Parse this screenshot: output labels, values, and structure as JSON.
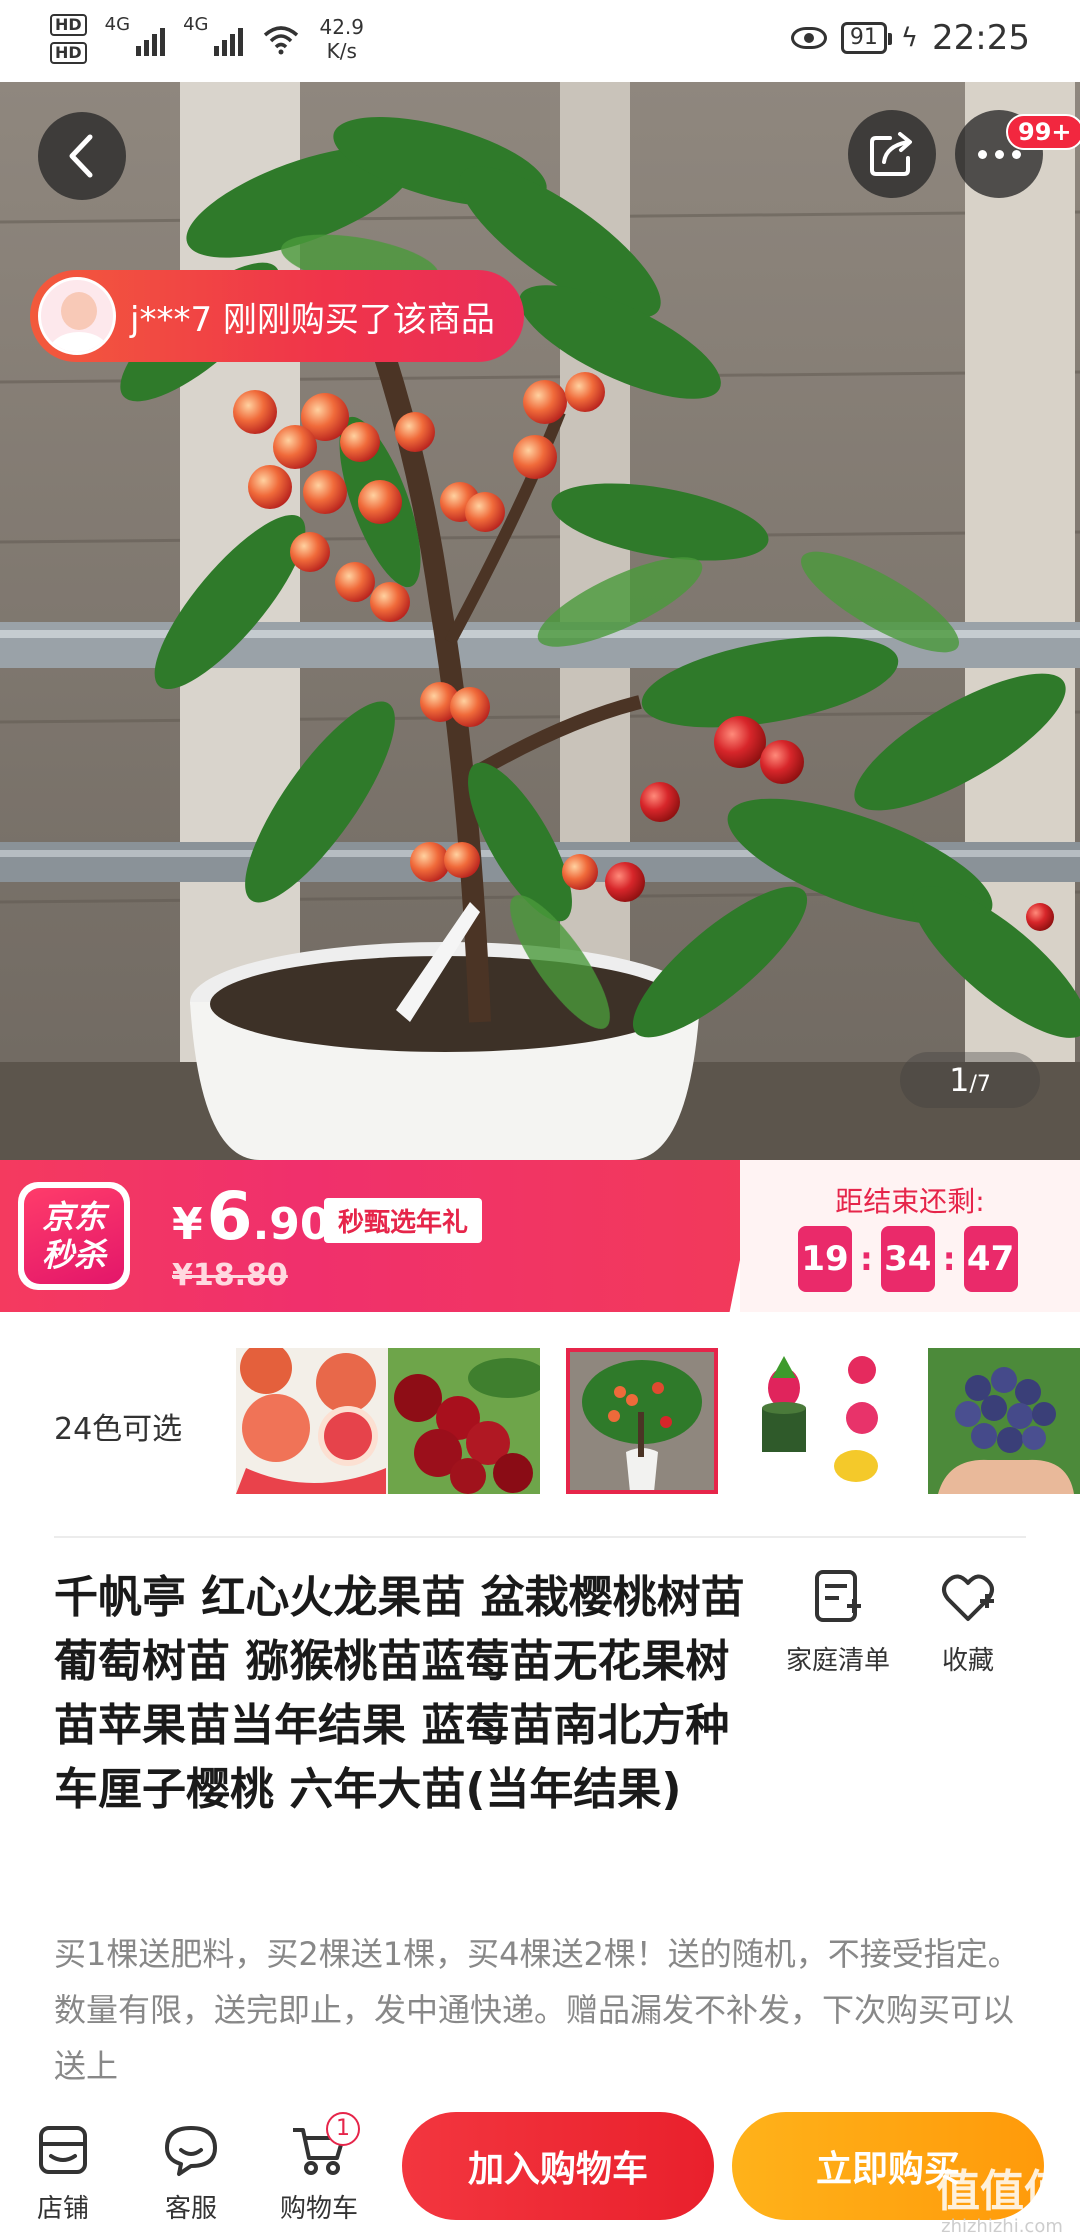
{
  "status_bar": {
    "hd1": "HD",
    "hd2": "HD",
    "net1": "4G",
    "net2": "4G",
    "speed_value": "42.9",
    "speed_unit": "K/s",
    "battery": "91",
    "time": "22:25"
  },
  "hero": {
    "buyer_notice": "j***7 刚刚购买了该商品",
    "more_badge": "99+",
    "page_current": "1",
    "page_total": "/7",
    "icons": {
      "back": "back-arrow-icon",
      "share": "share-icon",
      "more": "more-dots-icon"
    }
  },
  "flash_sale": {
    "logo_line1": "京东",
    "logo_line2": "秒杀",
    "price_currency": "¥",
    "price_int": "6",
    "price_dec": ".90",
    "tag": "秒甄选年礼",
    "original_price": "¥18.80",
    "countdown_label": "距结束还剩:",
    "hours": "19",
    "minutes": "34",
    "seconds": "47"
  },
  "variants": {
    "label": "24色可选",
    "items": [
      {
        "name": "grapefruit"
      },
      {
        "name": "cherry"
      },
      {
        "name": "cherry-tree",
        "selected": true
      },
      {
        "name": "dragon-fruit"
      },
      {
        "name": "blueberry"
      }
    ]
  },
  "product": {
    "title": "千帆亭 红心火龙果苗 盆栽樱桃树苗 葡萄树苗 猕猴桃苗蓝莓苗无花果树苗苹果苗当年结果 蓝莓苗南北方种 车厘子樱桃 六年大苗(当年结果)",
    "family_list": "家庭清单",
    "favorite": "收藏",
    "promo": "买1棵送肥料，买2棵送1棵，买4棵送2棵！送的随机，不接受指定。数量有限，送完即止，发中通快递。赠品漏发不补发，下次购买可以送上"
  },
  "bottom_bar": {
    "shop": "店铺",
    "service": "客服",
    "cart": "购物车",
    "cart_count": "1",
    "add_to_cart": "加入购物车",
    "buy_now": "立即购买"
  },
  "watermark": {
    "main": "值值值",
    "sub": "zhizhizhi.com"
  },
  "colors": {
    "accent_red": "#e6254a",
    "flash_pink": "#f0306c",
    "buy_orange": "#ff9a0a"
  }
}
